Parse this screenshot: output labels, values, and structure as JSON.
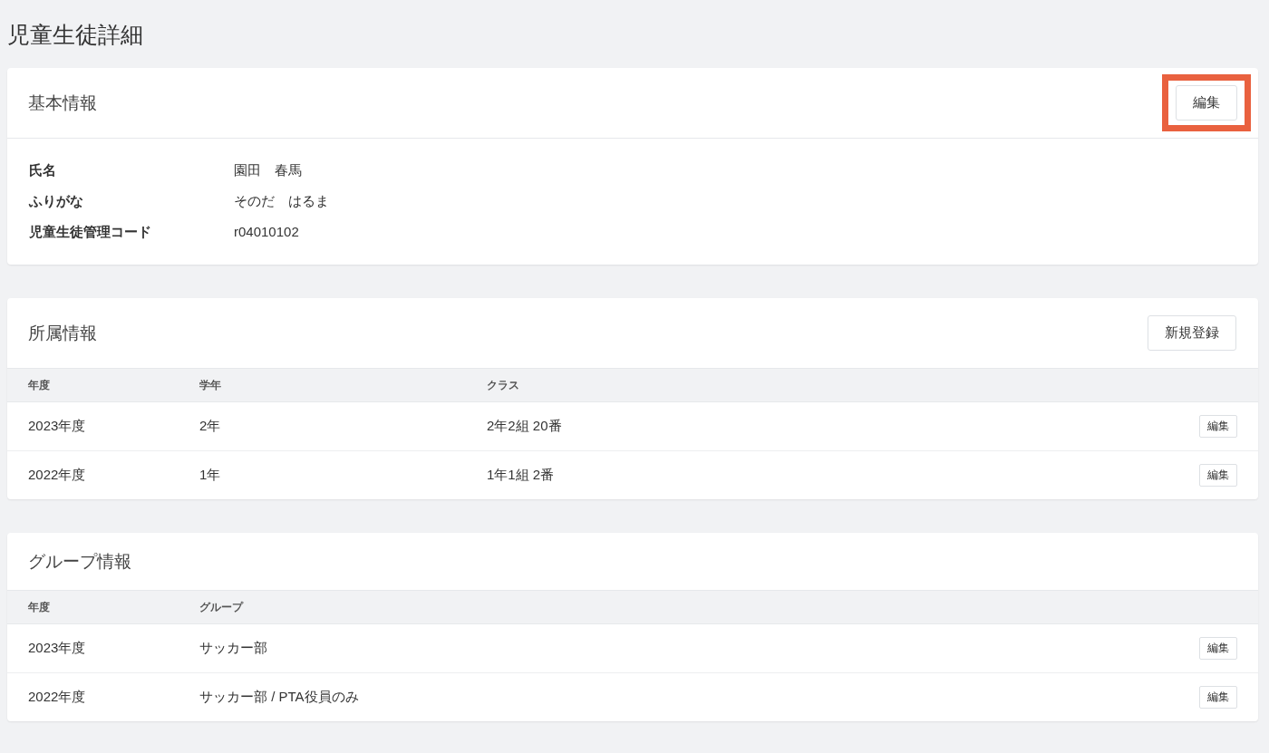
{
  "page_title": "児童生徒詳細",
  "basic_info": {
    "title": "基本情報",
    "edit_button": {
      "label": "編集",
      "highlighted": true
    },
    "fields": [
      {
        "label": "氏名",
        "value": "園田　春馬"
      },
      {
        "label": "ふりがな",
        "value": "そのだ　はるま"
      },
      {
        "label": "児童生徒管理コード",
        "value": "r04010102"
      }
    ]
  },
  "affiliation": {
    "title": "所属情報",
    "new_button": {
      "label": "新規登録"
    },
    "columns": [
      "年度",
      "学年",
      "クラス"
    ],
    "rows": [
      {
        "cells": [
          "2023年度",
          "2年",
          "2年2組 20番"
        ],
        "edit": "編集"
      },
      {
        "cells": [
          "2022年度",
          "1年",
          "1年1組 2番"
        ],
        "edit": "編集"
      }
    ]
  },
  "groups": {
    "title": "グループ情報",
    "columns": [
      "年度",
      "グループ"
    ],
    "rows": [
      {
        "cells": [
          "2023年度",
          "サッカー部"
        ],
        "edit": "編集"
      },
      {
        "cells": [
          "2022年度",
          "サッカー部 / PTA役員のみ"
        ],
        "edit": "編集"
      }
    ]
  }
}
